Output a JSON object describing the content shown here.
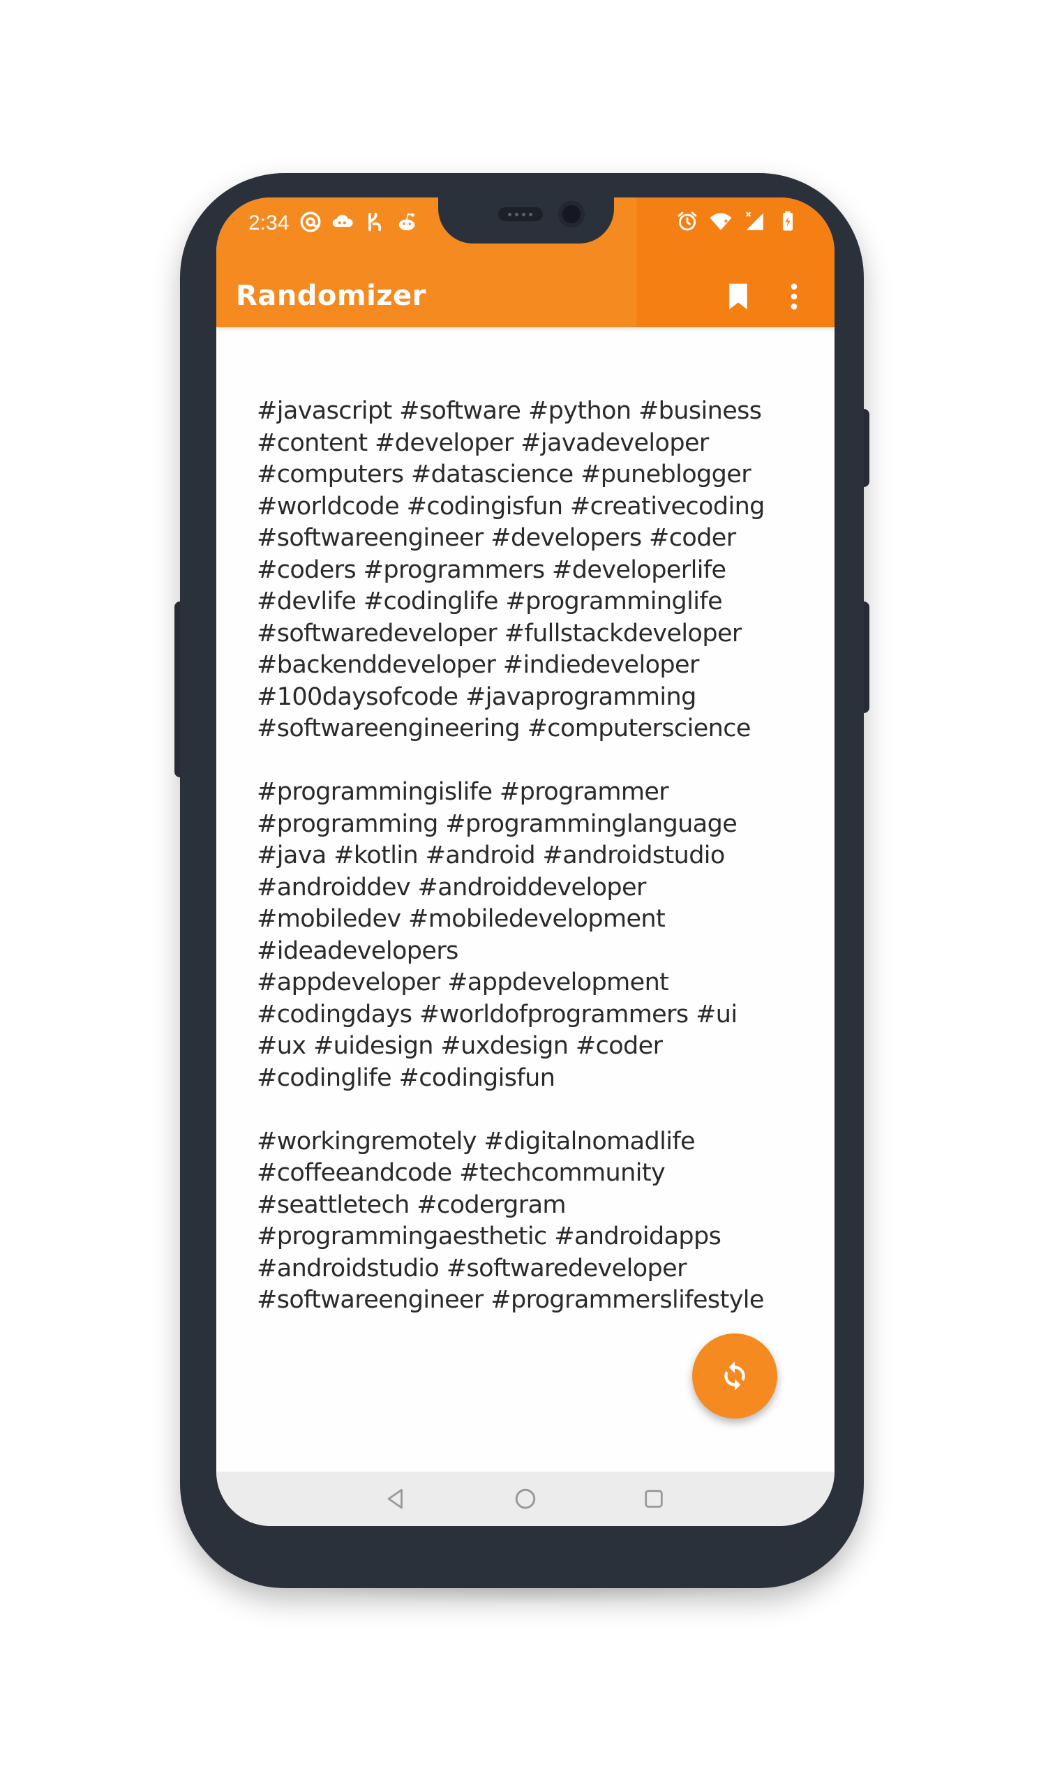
{
  "status_bar": {
    "time": "2:34",
    "left_icons": [
      "at-sign-icon",
      "cloud-game-icon",
      "fast-app-icon",
      "reddit-icon"
    ],
    "right_icons": [
      "alarm-icon",
      "wifi-icon",
      "signal-icon",
      "battery-charging-icon"
    ]
  },
  "toolbar": {
    "title": "Randomizer",
    "actions": [
      "bookmark-icon",
      "more-vert-icon"
    ]
  },
  "hashtags": {
    "blocks": [
      [
        "#javascript #software #python #business",
        "#content #developer #javadeveloper",
        "#computers #datascience #puneblogger",
        "#worldcode #codingisfun #creativecoding",
        "#softwareengineer #developers #coder",
        "#coders #programmers #developerlife",
        "#devlife #codinglife #programminglife",
        "#softwaredeveloper #fullstackdeveloper",
        "#backenddeveloper #indiedeveloper",
        "#100daysofcode #javaprogramming",
        "#softwareengineering #computerscience"
      ],
      [
        "#programmingislife #programmer",
        "#programming #programminglanguage",
        "#java #kotlin #android #androidstudio",
        "#androiddev #androiddeveloper",
        "#mobiledev #mobiledevelopment",
        "#ideadevelopers",
        "#appdeveloper #appdevelopment",
        "#codingdays #worldofprogrammers #ui",
        "#ux #uidesign #uxdesign #coder",
        "#codinglife #codingisfun"
      ],
      [
        "#workingremotely #digitalnomadlife",
        "#coffeeandcode #techcommunity",
        "#seattletech #codergram",
        "#programmingaesthetic #androidapps",
        "#androidstudio #softwaredeveloper",
        "#softwareengineer #programmerslifestyle"
      ]
    ]
  },
  "fab": {
    "icon": "refresh-icon"
  },
  "nav_bar": {
    "buttons": [
      "back-icon",
      "home-icon",
      "recents-icon"
    ]
  },
  "colors": {
    "accent": "#f58a20",
    "accent_dark": "#f47f12",
    "text": "#2a2a2a",
    "bezel": "#2b313b",
    "nav_bg": "#ececec"
  }
}
